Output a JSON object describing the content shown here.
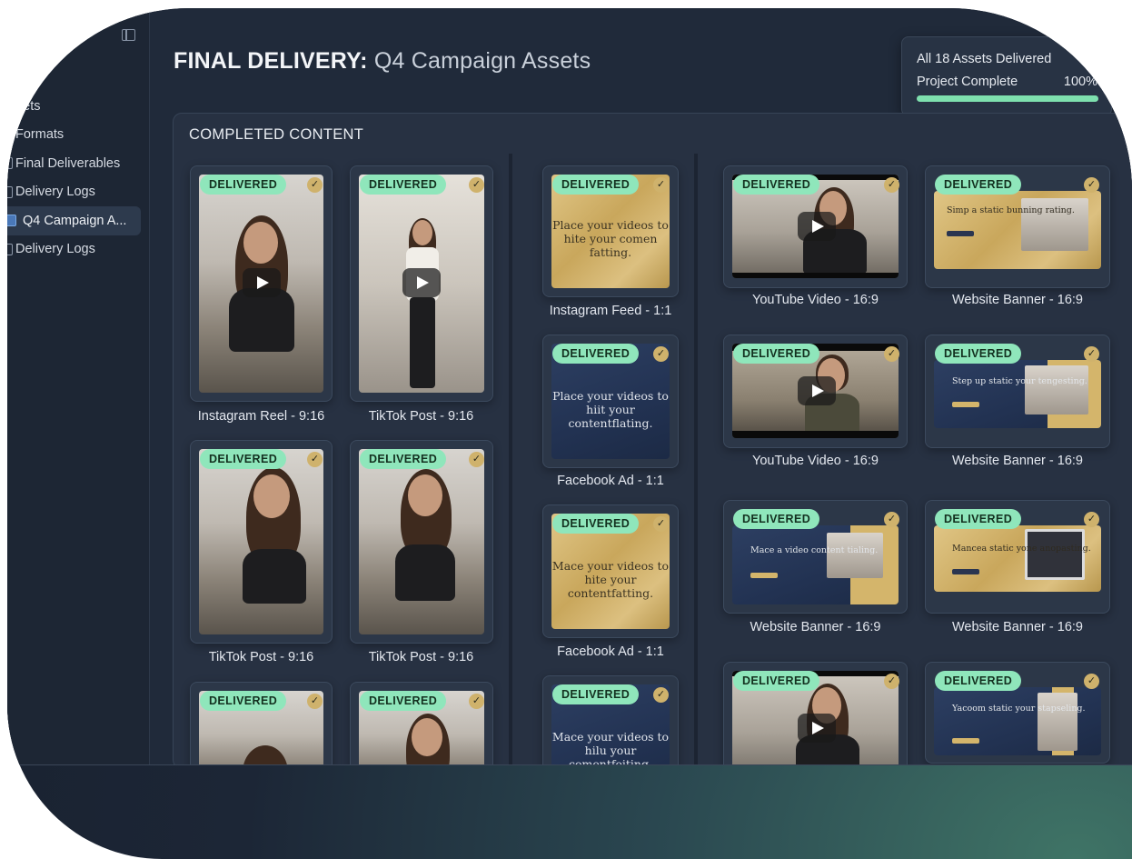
{
  "sidebar": {
    "items": [
      {
        "label": "Assets",
        "icon": "folder-icon"
      },
      {
        "label": "Formats",
        "icon": "file-icon"
      },
      {
        "label": "Final Deliverables",
        "icon": "file-icon"
      },
      {
        "label": "Delivery Logs",
        "icon": "file-icon"
      },
      {
        "label": "Q4 Campaign A...",
        "icon": "file-icon"
      },
      {
        "label": "Delivery Logs",
        "icon": "file-icon"
      }
    ]
  },
  "header": {
    "title_bold": "FINAL DELIVERY:",
    "title_rest": "Q4 Campaign Assets"
  },
  "status": {
    "line1": "All 18 Assets Delivered",
    "line2": "Project Complete",
    "percent_label": "100%",
    "progress": 1.0
  },
  "section": {
    "title": "COMPLETED CONTENT"
  },
  "badge_label": "DELIVERED",
  "check_glyph": "✓",
  "colors": {
    "badge": "#8fe6bb",
    "progress": "#7ee0ae",
    "check": "#cfb26c",
    "gold": "#c9a75c",
    "navy": "#223252"
  },
  "cards": {
    "reel1": {
      "caption": "Instagram Reel - 9:16"
    },
    "tiktok1": {
      "caption": "TikTok Post - 9:16"
    },
    "tiktok2": {
      "caption": "TikTok Post - 9:16"
    },
    "tiktok3": {
      "caption": "TikTok Post - 9:16"
    },
    "feed1": {
      "caption": "Instagram Feed - 1:1",
      "text": "Place your videos to hite your comen fatting."
    },
    "fb1": {
      "caption": "Facebook Ad - 1:1",
      "text": "Place your videos to hiit your contentflating."
    },
    "fb2": {
      "caption": "Facebook Ad - 1:1",
      "text": "Mace your videos to hite your contentfatting."
    },
    "sq4": {
      "text": "Mace your videos to hilu your comentfeiting."
    },
    "yt1": {
      "caption": "YouTube Video - 16:9"
    },
    "yt2": {
      "caption": "YouTube Video - 16:9"
    },
    "wb1": {
      "caption": "Website Banner - 16:9",
      "text": "Simp a static bunning rating."
    },
    "wb2": {
      "caption": "Website Banner - 16:9",
      "text": "Step up static your tengesting."
    },
    "wb3": {
      "caption": "Website Banner - 16:9",
      "text": "Mace a video content tialing."
    },
    "wb4": {
      "caption": "Website Banner - 16:9",
      "text": "Mancea static yone anopasting."
    },
    "wb5": {
      "text": "Yacoom static your stapseling."
    }
  }
}
